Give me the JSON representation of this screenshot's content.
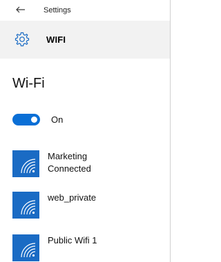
{
  "window": {
    "title": "Settings"
  },
  "header": {
    "icon": "gear-icon",
    "title": "WIFI"
  },
  "page": {
    "title": "Wi-Fi"
  },
  "wifi_toggle": {
    "state": "On",
    "enabled": true,
    "accent_color": "#0a6fd6"
  },
  "networks": [
    {
      "name": "Marketing",
      "status": "Connected",
      "icon": "wifi-signal-icon"
    },
    {
      "name": "web_private",
      "status": "",
      "icon": "wifi-signal-icon"
    },
    {
      "name": "Public Wifi 1",
      "status": "",
      "icon": "wifi-signal-icon"
    }
  ],
  "colors": {
    "icon_tile": "#1a6bc4",
    "header_bg": "#f2f2f2"
  }
}
